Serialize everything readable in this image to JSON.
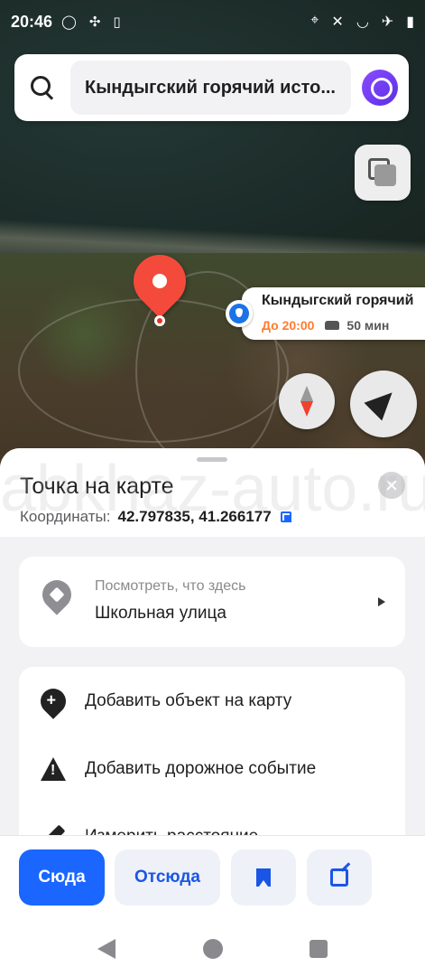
{
  "status": {
    "time": "20:46"
  },
  "search": {
    "query": "Кындыгский горячий исто..."
  },
  "poi": {
    "name": "Кындыгский горячий",
    "until": "До 20:00",
    "drive_time": "50 мин"
  },
  "sheet": {
    "title": "Точка на карте",
    "coords_label": "Координаты:",
    "coords_value": "42.797835, 41.266177",
    "place_hint": "Посмотреть, что здесь",
    "place_street": "Школьная улица",
    "actions": [
      "Добавить объект на карту",
      "Добавить дорожное событие",
      "Измерить расстояние"
    ]
  },
  "actionbar": {
    "here": "Сюда",
    "from": "Отсюда"
  },
  "watermark": "abkhaz-auto.ru",
  "colors": {
    "accent": "#1a66ff",
    "pin": "#f34a3c",
    "poi_open_until": "#ff7b2e"
  }
}
